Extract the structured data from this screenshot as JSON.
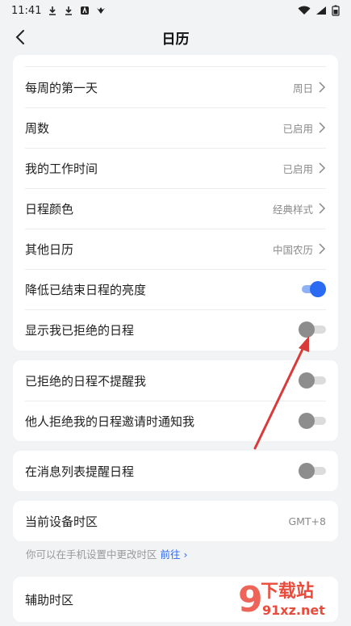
{
  "status_bar": {
    "time": "11:41"
  },
  "header": {
    "title": "日历"
  },
  "group1": [
    {
      "label": "每周的第一天",
      "value": "周日"
    },
    {
      "label": "周数",
      "value": "已启用"
    },
    {
      "label": "我的工作时间",
      "value": "已启用"
    },
    {
      "label": "日程颜色",
      "value": "经典样式"
    },
    {
      "label": "其他日历",
      "value": "中国农历"
    },
    {
      "label": "降低已结束日程的亮度",
      "toggle": true
    },
    {
      "label": "显示我已拒绝的日程",
      "toggle": false
    }
  ],
  "group2": [
    {
      "label": "已拒绝的日程不提醒我",
      "toggle": false
    },
    {
      "label": "他人拒绝我的日程邀请时通知我",
      "toggle": false
    }
  ],
  "group3": [
    {
      "label": "在消息列表提醒日程",
      "toggle": false
    }
  ],
  "timezone": {
    "label": "当前设备时区",
    "value": "GMT+8"
  },
  "hint": {
    "text": "你可以在手机设置中更改时区",
    "link": "前往"
  },
  "aux_timezone": {
    "label": "辅助时区"
  },
  "watermark": {
    "text": "下载站",
    "site": "91xz.net"
  },
  "colors": {
    "accent": "#2b6af3",
    "annotation_arrow": "#d93a3a"
  }
}
